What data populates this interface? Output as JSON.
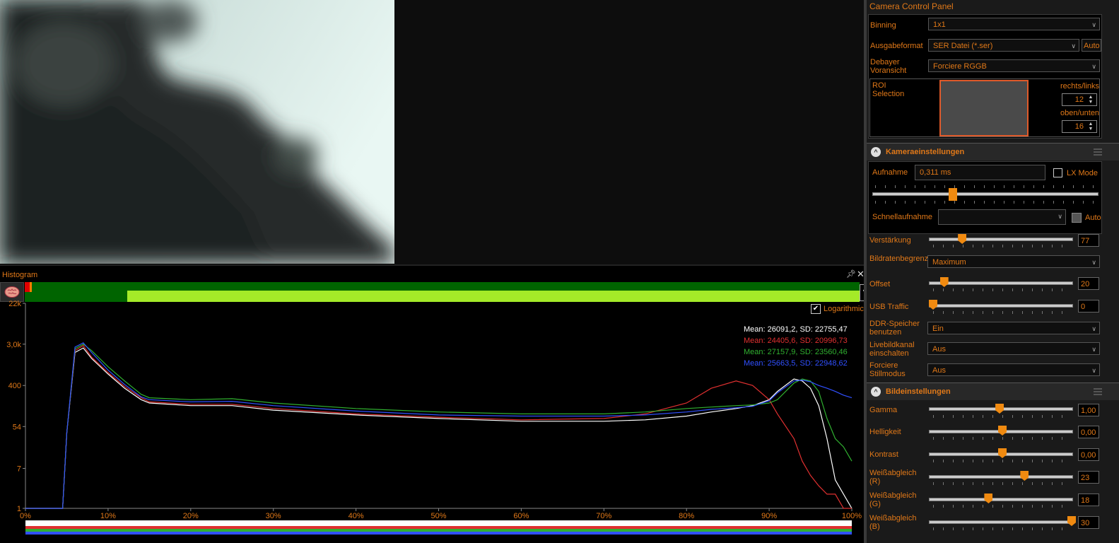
{
  "histogram": {
    "title": "Histogram",
    "logarithmic_label": "Logarithmic",
    "logarithmic_checked": true,
    "help_label": "?",
    "stats": [
      {
        "text": "Mean: 26091,2, SD: 22755,47",
        "color": "#ffffff"
      },
      {
        "text": "Mean: 24405,6, SD: 20996,73",
        "color": "#e03030"
      },
      {
        "text": "Mean: 27157,9, SD: 23560,46",
        "color": "#30b030"
      },
      {
        "text": "Mean: 25663,5, SD: 22948,62",
        "color": "#3050ff"
      }
    ]
  },
  "chart_data": {
    "type": "line",
    "xlabel": "",
    "ylabel": "",
    "log_scale": true,
    "y_tick_labels": [
      "22k",
      "3,0k",
      "400",
      "54",
      "7",
      "1"
    ],
    "x_tick_labels": [
      "0%",
      "10%",
      "20%",
      "30%",
      "40%",
      "50%",
      "60%",
      "70%",
      "80%",
      "90%",
      "100%"
    ],
    "x": [
      0,
      2,
      4.5,
      5,
      6,
      7,
      8,
      10,
      12,
      14,
      15,
      20,
      25,
      30,
      40,
      50,
      60,
      70,
      75,
      80,
      83,
      86,
      88,
      90,
      91,
      93,
      94,
      95,
      96,
      97,
      98,
      99,
      100
    ],
    "series": [
      {
        "name": "white",
        "color": "#ffffff",
        "values": [
          1,
          1,
          1,
          40,
          2000,
          2500,
          1500,
          700,
          350,
          200,
          170,
          150,
          150,
          120,
          95,
          80,
          70,
          70,
          75,
          90,
          110,
          130,
          150,
          200,
          300,
          550,
          500,
          350,
          150,
          30,
          4,
          2,
          1
        ]
      },
      {
        "name": "red",
        "color": "#e03030",
        "values": [
          1,
          1,
          1,
          40,
          2200,
          2800,
          1600,
          750,
          380,
          220,
          180,
          160,
          160,
          130,
          100,
          85,
          75,
          80,
          100,
          170,
          350,
          500,
          400,
          200,
          100,
          30,
          10,
          5,
          3,
          2,
          2,
          1,
          1
        ]
      },
      {
        "name": "green",
        "color": "#30b030",
        "values": [
          1,
          1,
          1,
          40,
          2400,
          3000,
          2200,
          1000,
          500,
          260,
          220,
          200,
          210,
          170,
          130,
          110,
          100,
          100,
          110,
          130,
          140,
          150,
          155,
          170,
          200,
          450,
          550,
          500,
          300,
          80,
          30,
          20,
          10
        ]
      },
      {
        "name": "blue",
        "color": "#3050ff",
        "values": [
          1,
          1,
          1,
          40,
          2600,
          3200,
          2000,
          850,
          420,
          230,
          200,
          180,
          185,
          150,
          115,
          95,
          90,
          90,
          95,
          110,
          125,
          135,
          145,
          190,
          280,
          500,
          520,
          480,
          400,
          350,
          300,
          250,
          220
        ]
      }
    ]
  },
  "panel": {
    "title": "Camera Control Panel",
    "binning": {
      "label": "Binning",
      "value": "1x1"
    },
    "output_format": {
      "label": "Ausgabeformat",
      "value": "SER Datei (*.ser)",
      "auto": "Auto"
    },
    "debayer": {
      "label": "Debayer Voransicht",
      "value": "Forciere RGGB"
    },
    "roi": {
      "label": "ROI Selection",
      "lr_label": "rechts/links",
      "lr_value": "12",
      "tb_label": "oben/unten",
      "tb_value": "16"
    },
    "camera_section": {
      "title": "Kameraeinstellungen",
      "exposure_label": "Aufnahme",
      "exposure_value": "0,311 ms",
      "lx_mode": "LX Mode",
      "exposure_slider": 0.36,
      "quick_label": "Schnellaufnahme",
      "quick_value": "",
      "quick_auto": "Auto",
      "gain_label": "Verstärkung",
      "gain_value": "77",
      "gain_slider": 0.21,
      "framerate_label": "Bildratenbegrenzung",
      "framerate_value": "Maximum",
      "offset_label": "Offset",
      "offset_value": "20",
      "offset_slider": 0.08,
      "usb_label": "USB Traffic",
      "usb_value": "0",
      "usb_slider": 0.0,
      "ddr_label": "DDR-Speicher benutzen",
      "ddr_value": "Ein",
      "live_label": "Livebildkanal einschalten",
      "live_value": "Aus",
      "still_label": "Forciere Stillmodus",
      "still_value": "Aus"
    },
    "image_section": {
      "title": "Bildeinstellungen",
      "gamma_label": "Gamma",
      "gamma_value": "1,00",
      "gamma_slider": 0.48,
      "brightness_label": "Helligkeit",
      "brightness_value": "0,00",
      "brightness_slider": 0.5,
      "contrast_label": "Kontrast",
      "contrast_value": "0,00",
      "contrast_slider": 0.5,
      "wb_r_label": "Weißabgleich (R)",
      "wb_r_value": "23",
      "wb_r_slider": 0.66,
      "wb_g_label": "Weißabgleich (G)",
      "wb_g_value": "18",
      "wb_g_slider": 0.4,
      "wb_b_label": "Weißabgleich (B)",
      "wb_b_value": "30",
      "wb_b_slider": 1.0
    }
  }
}
